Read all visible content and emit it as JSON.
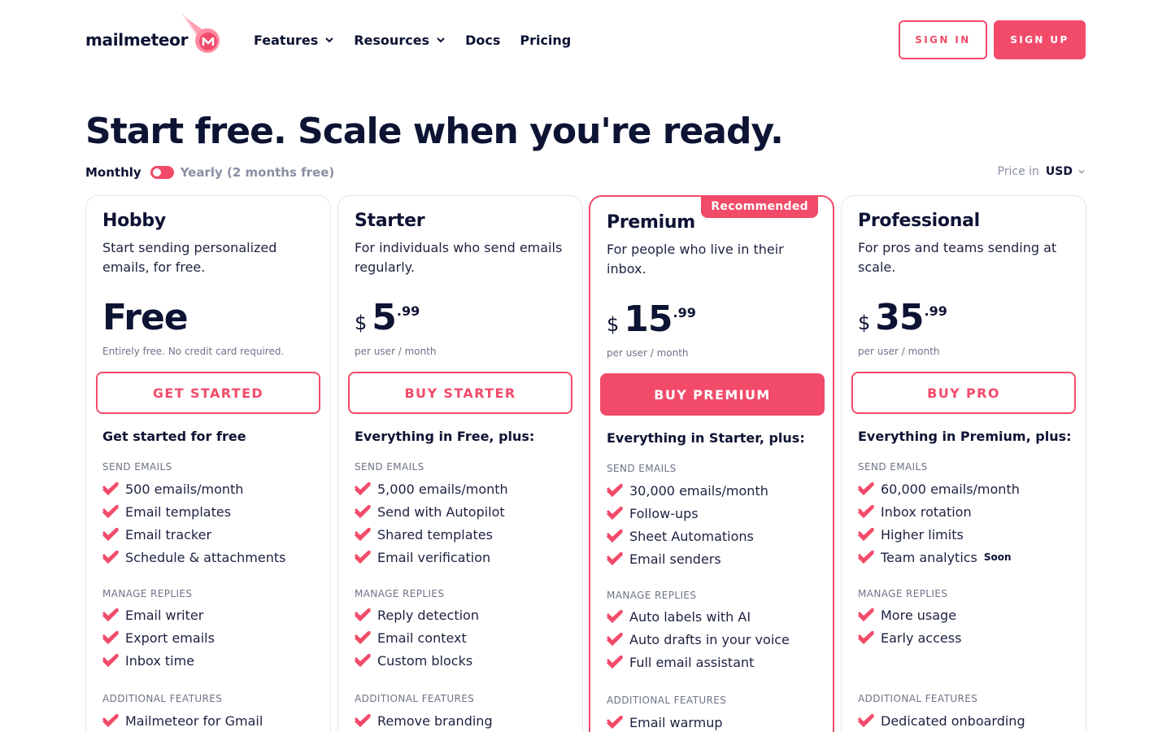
{
  "brand": {
    "name": "mailmeteor",
    "accent": "#f24b6a",
    "ink": "#0d1333"
  },
  "nav": {
    "items": [
      {
        "label": "Features",
        "has_dropdown": true
      },
      {
        "label": "Resources",
        "has_dropdown": true
      },
      {
        "label": "Docs",
        "has_dropdown": false
      },
      {
        "label": "Pricing",
        "has_dropdown": false
      }
    ],
    "signin": "SIGN IN",
    "signup": "SIGN UP"
  },
  "hero": {
    "title": "Start free. Scale when you're ready.",
    "billing_monthly": "Monthly",
    "billing_yearly": "Yearly (2 months free)",
    "currency_label": "Price in",
    "currency_value": "USD"
  },
  "plans": [
    {
      "name": "Hobby",
      "desc": "Start sending personalized emails, for free.",
      "price_text": "Free",
      "note": "Entirely free. No credit card required.",
      "cta": "GET STARTED",
      "includes": "Get started for free",
      "sections": [
        {
          "label": "SEND EMAILS",
          "items": [
            "500 emails/month",
            "Email templates",
            "Email tracker",
            "Schedule & attachments"
          ]
        },
        {
          "label": "MANAGE REPLIES",
          "items": [
            "Email writer",
            "Export emails",
            "Inbox time"
          ]
        },
        {
          "label": "ADDITIONAL FEATURES",
          "items": [
            "Mailmeteor for Gmail"
          ]
        }
      ]
    },
    {
      "name": "Starter",
      "desc": "For individuals who send emails regularly.",
      "currency_symbol": "$",
      "price_main": "5",
      "price_cents": ".99",
      "note": "per user / month",
      "cta": "BUY STARTER",
      "includes": "Everything in Free, plus:",
      "sections": [
        {
          "label": "SEND EMAILS",
          "items": [
            "5,000 emails/month",
            "Send with Autopilot",
            "Shared templates",
            "Email verification"
          ]
        },
        {
          "label": "MANAGE REPLIES",
          "items": [
            "Reply detection",
            "Email context",
            "Custom blocks"
          ]
        },
        {
          "label": "ADDITIONAL FEATURES",
          "items": [
            "Remove branding"
          ]
        }
      ]
    },
    {
      "name": "Premium",
      "badge": "Recommended",
      "desc": "For people who live in their inbox.",
      "currency_symbol": "$",
      "price_main": "15",
      "price_cents": ".99",
      "note": "per user / month",
      "cta": "BUY PREMIUM",
      "includes": "Everything in Starter, plus:",
      "sections": [
        {
          "label": "SEND EMAILS",
          "items": [
            "30,000 emails/month",
            "Follow-ups",
            "Sheet Automations",
            "Email senders"
          ]
        },
        {
          "label": "MANAGE REPLIES",
          "items": [
            "Auto labels with AI",
            "Auto drafts in your voice",
            "Full email assistant"
          ]
        },
        {
          "label": "ADDITIONAL FEATURES",
          "items": [
            "Email warmup"
          ]
        }
      ]
    },
    {
      "name": "Professional",
      "desc": "For pros and teams sending at scale.",
      "currency_symbol": "$",
      "price_main": "35",
      "price_cents": ".99",
      "note": "per user / month",
      "cta": "BUY PRO",
      "includes": "Everything in Premium, plus:",
      "soon_label": "Soon",
      "sections": [
        {
          "label": "SEND EMAILS",
          "items": [
            "60,000 emails/month",
            "Inbox rotation",
            "Higher limits",
            "Team analytics"
          ]
        },
        {
          "label": "MANAGE REPLIES",
          "items": [
            "More usage",
            "Early access"
          ]
        },
        {
          "label": "ADDITIONAL FEATURES",
          "items": [
            "Dedicated onboarding"
          ]
        }
      ]
    }
  ]
}
